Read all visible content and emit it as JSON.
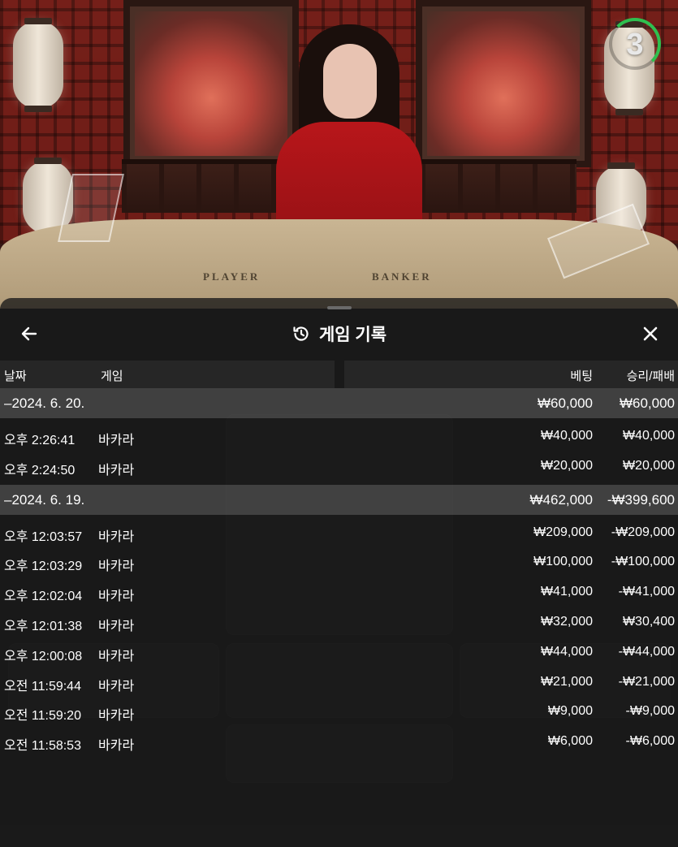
{
  "timer": {
    "value": "3",
    "progress": 0.25,
    "accent": "#2fbf4f"
  },
  "table_labels": {
    "player": "PLAYER",
    "banker": "BANKER"
  },
  "panel": {
    "title": "게임 기록",
    "back_icon": "arrow-left-icon",
    "history_icon": "history-icon",
    "close_icon": "close-icon"
  },
  "columns": {
    "date": "날짜",
    "game": "게임",
    "bet": "베팅",
    "result": "승리/패배"
  },
  "groups": [
    {
      "date": "–2024. 6. 20.",
      "bet": "₩60,000",
      "result": "₩60,000",
      "items": [
        {
          "time": "오후 2:26:41",
          "game": "바카라",
          "bet": "₩40,000",
          "result": "₩40,000"
        },
        {
          "time": "오후 2:24:50",
          "game": "바카라",
          "bet": "₩20,000",
          "result": "₩20,000"
        }
      ]
    },
    {
      "date": "–2024. 6. 19.",
      "bet": "₩462,000",
      "result": "-₩399,600",
      "items": [
        {
          "time": "오후 12:03:57",
          "game": "바카라",
          "bet": "₩209,000",
          "result": "-₩209,000"
        },
        {
          "time": "오후 12:03:29",
          "game": "바카라",
          "bet": "₩100,000",
          "result": "-₩100,000"
        },
        {
          "time": "오후 12:02:04",
          "game": "바카라",
          "bet": "₩41,000",
          "result": "-₩41,000"
        },
        {
          "time": "오후 12:01:38",
          "game": "바카라",
          "bet": "₩32,000",
          "result": "₩30,400"
        },
        {
          "time": "오후 12:00:08",
          "game": "바카라",
          "bet": "₩44,000",
          "result": "-₩44,000"
        },
        {
          "time": "오전 11:59:44",
          "game": "바카라",
          "bet": "₩21,000",
          "result": "-₩21,000"
        },
        {
          "time": "오전 11:59:20",
          "game": "바카라",
          "bet": "₩9,000",
          "result": "-₩9,000"
        },
        {
          "time": "오전 11:58:53",
          "game": "바카라",
          "bet": "₩6,000",
          "result": "-₩6,000"
        }
      ]
    }
  ]
}
